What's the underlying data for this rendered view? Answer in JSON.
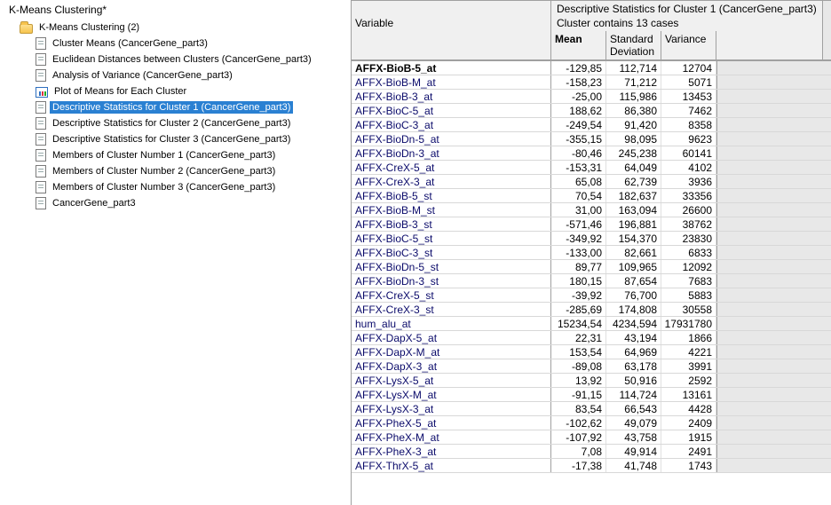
{
  "tree": {
    "title": "K-Means Clustering*",
    "root": "K-Means Clustering (2)",
    "items": [
      {
        "k": "doc",
        "t": "Cluster Means (CancerGene_part3)"
      },
      {
        "k": "doc",
        "t": "Euclidean Distances between Clusters (CancerGene_part3)"
      },
      {
        "k": "doc",
        "t": "Analysis of Variance (CancerGene_part3)"
      },
      {
        "k": "plot",
        "t": "Plot of Means for Each Cluster"
      },
      {
        "k": "doc",
        "t": "Descriptive Statistics for Cluster 1 (CancerGene_part3)",
        "sel": true
      },
      {
        "k": "doc",
        "t": "Descriptive Statistics for Cluster 2 (CancerGene_part3)"
      },
      {
        "k": "doc",
        "t": "Descriptive Statistics for Cluster 3 (CancerGene_part3)"
      },
      {
        "k": "doc",
        "t": "Members of Cluster Number 1 (CancerGene_part3)"
      },
      {
        "k": "doc",
        "t": "Members of Cluster Number 2 (CancerGene_part3)"
      },
      {
        "k": "doc",
        "t": "Members of Cluster Number 3 (CancerGene_part3)"
      },
      {
        "k": "doc",
        "t": "CancerGene_part3"
      }
    ]
  },
  "grid": {
    "title1": "Descriptive Statistics for Cluster 1 (CancerGene_part3)",
    "title2": "Cluster contains 13 cases",
    "varHeader": "Variable",
    "cols": [
      "Mean",
      "Standard Deviation",
      "Variance"
    ],
    "rows": [
      [
        "AFFX-BioB-5_at",
        "-129,85",
        "112,714",
        "12704"
      ],
      [
        "AFFX-BioB-M_at",
        "-158,23",
        "71,212",
        "5071"
      ],
      [
        "AFFX-BioB-3_at",
        "-25,00",
        "115,986",
        "13453"
      ],
      [
        "AFFX-BioC-5_at",
        "188,62",
        "86,380",
        "7462"
      ],
      [
        "AFFX-BioC-3_at",
        "-249,54",
        "91,420",
        "8358"
      ],
      [
        "AFFX-BioDn-5_at",
        "-355,15",
        "98,095",
        "9623"
      ],
      [
        "AFFX-BioDn-3_at",
        "-80,46",
        "245,238",
        "60141"
      ],
      [
        "AFFX-CreX-5_at",
        "-153,31",
        "64,049",
        "4102"
      ],
      [
        "AFFX-CreX-3_at",
        "65,08",
        "62,739",
        "3936"
      ],
      [
        "AFFX-BioB-5_st",
        "70,54",
        "182,637",
        "33356"
      ],
      [
        "AFFX-BioB-M_st",
        "31,00",
        "163,094",
        "26600"
      ],
      [
        "AFFX-BioB-3_st",
        "-571,46",
        "196,881",
        "38762"
      ],
      [
        "AFFX-BioC-5_st",
        "-349,92",
        "154,370",
        "23830"
      ],
      [
        "AFFX-BioC-3_st",
        "-133,00",
        "82,661",
        "6833"
      ],
      [
        "AFFX-BioDn-5_st",
        "89,77",
        "109,965",
        "12092"
      ],
      [
        "AFFX-BioDn-3_st",
        "180,15",
        "87,654",
        "7683"
      ],
      [
        "AFFX-CreX-5_st",
        "-39,92",
        "76,700",
        "5883"
      ],
      [
        "AFFX-CreX-3_st",
        "-285,69",
        "174,808",
        "30558"
      ],
      [
        "hum_alu_at",
        "15234,54",
        "4234,594",
        "17931780"
      ],
      [
        "AFFX-DapX-5_at",
        "22,31",
        "43,194",
        "1866"
      ],
      [
        "AFFX-DapX-M_at",
        "153,54",
        "64,969",
        "4221"
      ],
      [
        "AFFX-DapX-3_at",
        "-89,08",
        "63,178",
        "3991"
      ],
      [
        "AFFX-LysX-5_at",
        "13,92",
        "50,916",
        "2592"
      ],
      [
        "AFFX-LysX-M_at",
        "-91,15",
        "114,724",
        "13161"
      ],
      [
        "AFFX-LysX-3_at",
        "83,54",
        "66,543",
        "4428"
      ],
      [
        "AFFX-PheX-5_at",
        "-102,62",
        "49,079",
        "2409"
      ],
      [
        "AFFX-PheX-M_at",
        "-107,92",
        "43,758",
        "1915"
      ],
      [
        "AFFX-PheX-3_at",
        "7,08",
        "49,914",
        "2491"
      ],
      [
        "AFFX-ThrX-5_at",
        "-17,38",
        "41,748",
        "1743"
      ]
    ]
  }
}
